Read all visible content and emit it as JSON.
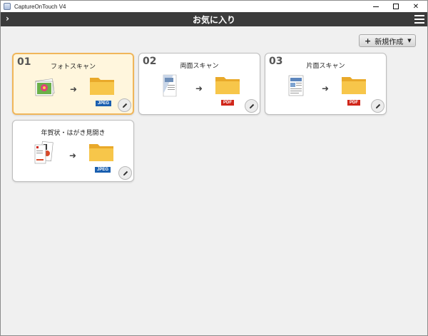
{
  "window": {
    "title": "CaptureOnTouch V4"
  },
  "header": {
    "title": "お気に入り"
  },
  "toolbar": {
    "new_button_label": "新規作成"
  },
  "cards": [
    {
      "number": "01",
      "name": "フォトスキャン",
      "format": "JPEG",
      "selected": true
    },
    {
      "number": "02",
      "name": "両面スキャン",
      "format": "PDF",
      "selected": false
    },
    {
      "number": "03",
      "name": "片面スキャン",
      "format": "PDF",
      "selected": false
    },
    {
      "number": "",
      "name": "年賀状・はがき見開き",
      "format": "JPEG",
      "selected": false
    }
  ],
  "colors": {
    "header_bg": "#3b3b3b",
    "selected_card_bg": "#fff6dd",
    "selected_card_border": "#f0b65a",
    "jpeg_badge": "#1a5fb0",
    "pdf_badge": "#d0261a",
    "folder": "#f5bb3c"
  }
}
